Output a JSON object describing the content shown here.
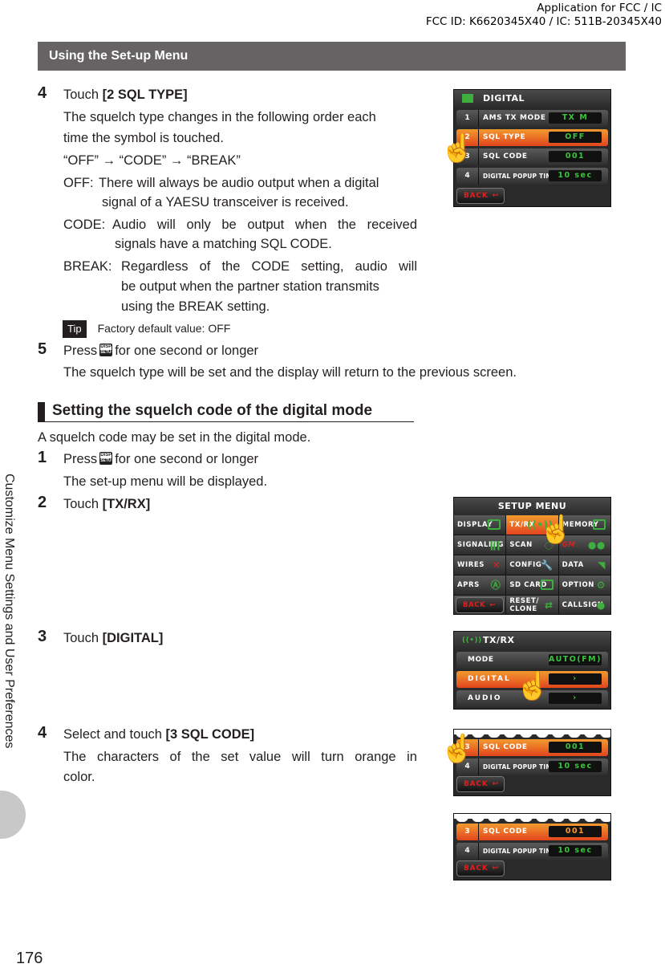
{
  "header": {
    "fcc_line1": "Application for FCC / IC",
    "fcc_line2": "FCC ID: K6620345X40 / IC: 511B-20345X40"
  },
  "sidebar": {
    "chapter_title": "Customize Menu Settings and User Preferences"
  },
  "page_number": "176",
  "section_title": "Using the Set-up Menu",
  "part1": {
    "step4": {
      "number": "4",
      "prefix": "Touch ",
      "target": "[2 SQL TYPE]",
      "desc_line1": "The squelch type changes in the following order each",
      "desc_line2": "time the symbol is touched.",
      "order": "“OFF” → “CODE” → “BREAK”",
      "off_label": "OFF:",
      "off_line1": "There will always be audio output when a digital",
      "off_line2": "signal of a YAESU transceiver is received.",
      "code_label": "CODE:",
      "code_line1": "Audio will only be output when the received",
      "code_line2": "signals have a matching SQL CODE.",
      "break_label": "BREAK:",
      "break_line1": "Regardless of the CODE setting, audio will",
      "break_line2": "be output when the partner station transmits",
      "break_line3": "using the BREAK setting.",
      "tip_label": "Tip",
      "tip_text": "Factory default value: OFF"
    },
    "step5": {
      "number": "5",
      "prefix": "Press",
      "key_top": "DISP",
      "key_bottom": "SETUP",
      "suffix": "for one second or longer",
      "desc": "The squelch type will be set and the display will return to the previous screen."
    }
  },
  "part2": {
    "title": "Setting the squelch code of the digital mode",
    "intro": "A squelch code may be set in the digital mode.",
    "step1": {
      "number": "1",
      "prefix": "Press",
      "suffix": "for one second or longer",
      "desc": "The set-up menu will be displayed."
    },
    "step2": {
      "number": "2",
      "prefix": "Touch ",
      "target": "[TX/RX]"
    },
    "step3": {
      "number": "3",
      "prefix": "Touch ",
      "target": "[DIGITAL]"
    },
    "step4": {
      "number": "4",
      "prefix": "Select and touch ",
      "target": "[3 SQL CODE]",
      "desc_line1": "The characters of the set value will turn orange in",
      "desc_line2": "color."
    }
  },
  "screens": {
    "digital": {
      "title": "DIGITAL",
      "rows": [
        {
          "n": "1",
          "label": "AMS TX MODE",
          "value": "TX M"
        },
        {
          "n": "2",
          "label": "SQL TYPE",
          "value": "OFF"
        },
        {
          "n": "3",
          "label": "SQL CODE",
          "value": "001"
        },
        {
          "n": "4",
          "label": "DIGITAL POPUP TIME",
          "value": "10 sec"
        }
      ],
      "back": "BACK"
    },
    "setup": {
      "title": "SETUP MENU",
      "cells": [
        "DISPLAY",
        "TX/RX",
        "MEMORY",
        "SIGNALING",
        "SCAN",
        "GM",
        "WIRES",
        "CONFIG",
        "DATA",
        "APRS",
        "SD CARD",
        "OPTION",
        "BACK",
        "RESET/",
        "CALLSIGN"
      ],
      "reset_line2": "CLONE"
    },
    "txrx": {
      "title": "TX/RX",
      "rows": [
        {
          "label": "MODE",
          "value": "AUTO(FM)"
        },
        {
          "label": "DIGITAL",
          "value": "›"
        },
        {
          "label": "AUDIO",
          "value": "›"
        }
      ]
    },
    "sqlcode_a": {
      "rows": [
        {
          "n": "3",
          "label": "SQL CODE",
          "value": "001"
        },
        {
          "n": "4",
          "label": "DIGITAL POPUP TIME",
          "value": "10 sec"
        }
      ],
      "back": "BACK"
    },
    "sqlcode_b": {
      "rows": [
        {
          "n": "3",
          "label": "SQL CODE",
          "value": "001"
        },
        {
          "n": "4",
          "label": "DIGITAL POPUP TIME",
          "value": "10 sec"
        }
      ],
      "back": "BACK"
    }
  },
  "colors": {
    "selected_orange": "#f29a2e",
    "value_green": "#3ec23e",
    "back_red": "#e21e1e",
    "section_bar": "#666364"
  }
}
